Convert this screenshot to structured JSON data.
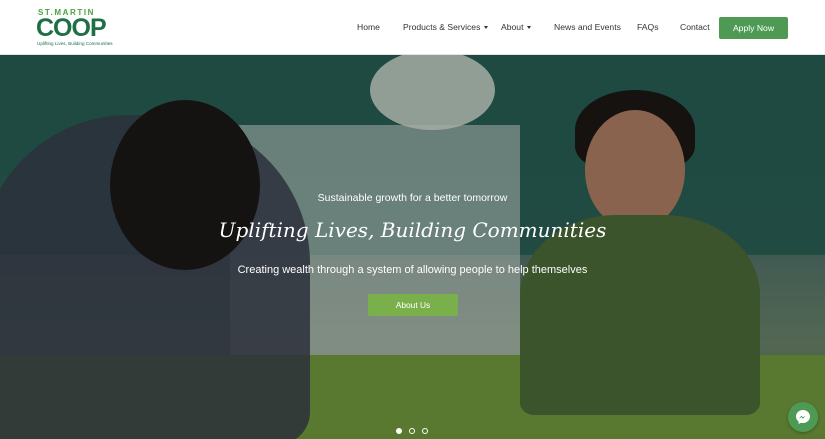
{
  "logo": {
    "top_text": "ST.MARTIN",
    "main_text": "COOP",
    "tagline": "Uplifting Lives, Building Communities"
  },
  "nav": {
    "home": "Home",
    "products": "Products & Services",
    "about": "About",
    "news": "News and Events",
    "faqs": "FAQs",
    "contact": "Contact",
    "apply": "Apply Now"
  },
  "hero": {
    "tagline": "Sustainable growth for a better tomorrow",
    "headline": "Uplifting Lives, Building Communities",
    "subline": "Creating wealth through a system of allowing people to help themselves",
    "button": "About Us",
    "slides_total": 3,
    "active_slide": 1
  },
  "colors": {
    "brand_green": "#4e9a55",
    "brand_dark_green": "#1f6f46",
    "button_light_green": "#7ab04c"
  },
  "icons": {
    "messenger": "messenger-icon",
    "dropdown": "chevron-down-icon"
  }
}
